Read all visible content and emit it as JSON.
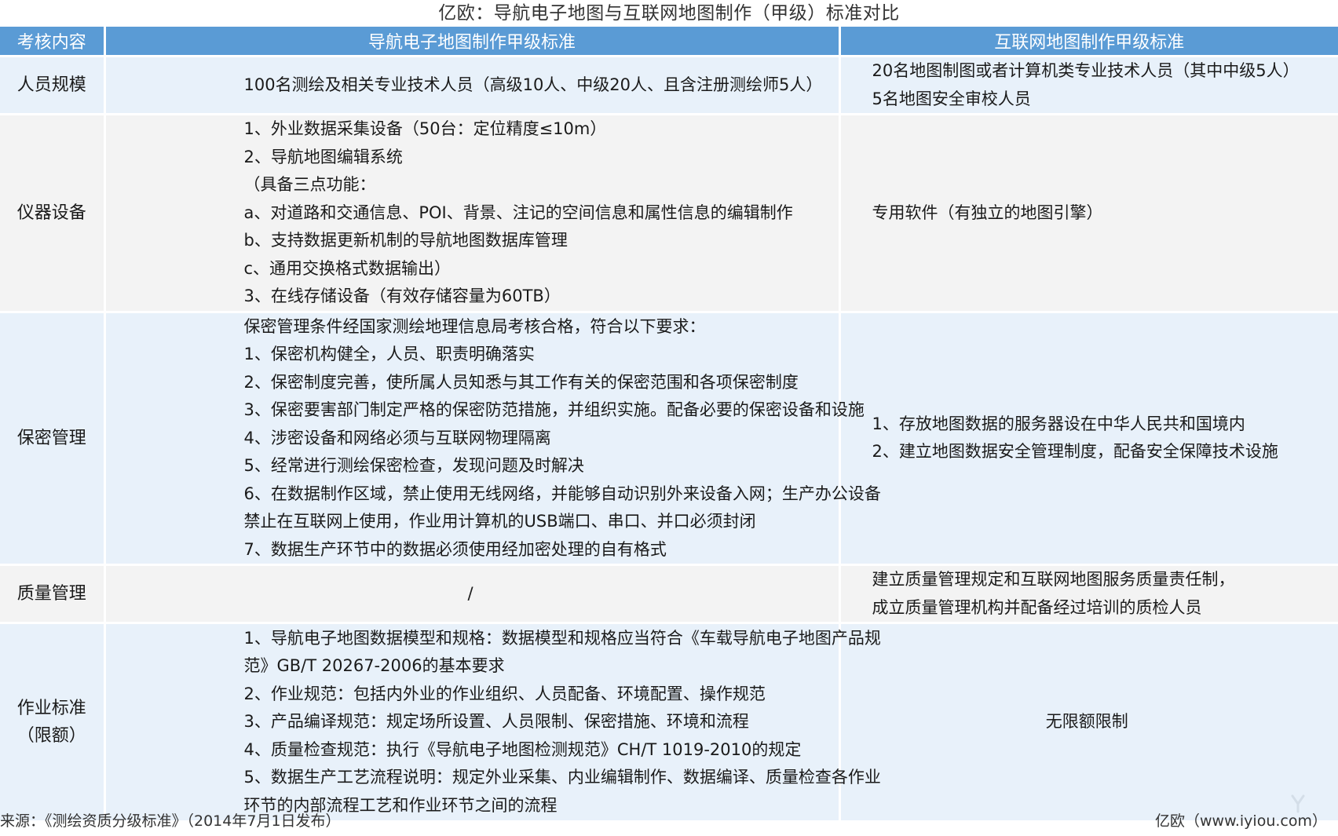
{
  "title": "亿欧：导航电子地图与互联网地图制作（甲级）标准对比",
  "table": {
    "headers": [
      "考核内容",
      "导航电子地图制作甲级标准",
      "互联网地图制作甲级标准"
    ],
    "rows": [
      {
        "category": [
          "人员规模"
        ],
        "nav": [
          "100名测绘及相关专业技术人员（高级10人、中级20人、且含注册测绘师5人）"
        ],
        "web": [
          "20名地图制图或者计算机类专业技术人员（其中中级5人）",
          "5名地图安全审校人员"
        ]
      },
      {
        "category": [
          "仪器设备"
        ],
        "nav": [
          "1、外业数据采集设备（50台：定位精度≤10m）",
          "2、导航地图编辑系统",
          "（具备三点功能：",
          "a、对道路和交通信息、POI、背景、注记的空间信息和属性信息的编辑制作",
          "b、支持数据更新机制的导航地图数据库管理",
          "c、通用交换格式数据输出）",
          "3、在线存储设备（有效存储容量为60TB）"
        ],
        "web": [
          "专用软件（有独立的地图引擎）"
        ]
      },
      {
        "category": [
          "保密管理"
        ],
        "nav": [
          "保密管理条件经国家测绘地理信息局考核合格，符合以下要求：",
          "1、保密机构健全，人员、职责明确落实",
          "2、保密制度完善，使所属人员知悉与其工作有关的保密范围和各项保密制度",
          "3、保密要害部门制定严格的保密防范措施，并组织实施。配备必要的保密设备和设施",
          "4、涉密设备和网络必须与互联网物理隔离",
          "5、经常进行测绘保密检查，发现问题及时解决",
          "6、在数据制作区域，禁止使用无线网络，并能够自动识别外来设备入网；生产办公设备",
          "禁止在互联网上使用，作业用计算机的USB端口、串口、并口必须封闭",
          "7、数据生产环节中的数据必须使用经加密处理的自有格式"
        ],
        "web": [
          "1、存放地图数据的服务器设在中华人民共和国境内",
          "2、建立地图数据安全管理制度，配备安全保障技术设施"
        ]
      },
      {
        "category": [
          "质量管理"
        ],
        "nav": [
          "/"
        ],
        "web": [
          "建立质量管理规定和互联网地图服务质量责任制，",
          "成立质量管理机构并配备经过培训的质检人员"
        ]
      },
      {
        "category": [
          "作业标准",
          "（限额）"
        ],
        "nav": [
          "1、导航电子地图数据模型和规格：数据模型和规格应当符合《车载导航电子地图产品规",
          "范》GB/T 20267-2006的基本要求",
          "2、作业规范：包括内外业的作业组织、人员配备、环境配置、操作规范",
          "3、产品编译规范：规定场所设置、人员限制、保密措施、环境和流程",
          "4、质量检查规范：执行《导航电子地图检测规范》CH/T 1019-2010的规定",
          "5、数据生产工艺流程说明：规定外业采集、内业编辑制作、数据编译、质量检查各作业",
          "环节的内部流程工艺和作业环节之间的流程"
        ],
        "web": [
          "无限额限制"
        ]
      }
    ]
  },
  "footer": {
    "source": "来源：《测绘资质分级标准》（2014年7月1日发布）",
    "brand": "亿欧（www.iyiou.com）"
  },
  "colors": {
    "header_bg": "#5a9bd5",
    "row_blue": "#e8f1fa",
    "row_gray": "#f3f3f3"
  }
}
